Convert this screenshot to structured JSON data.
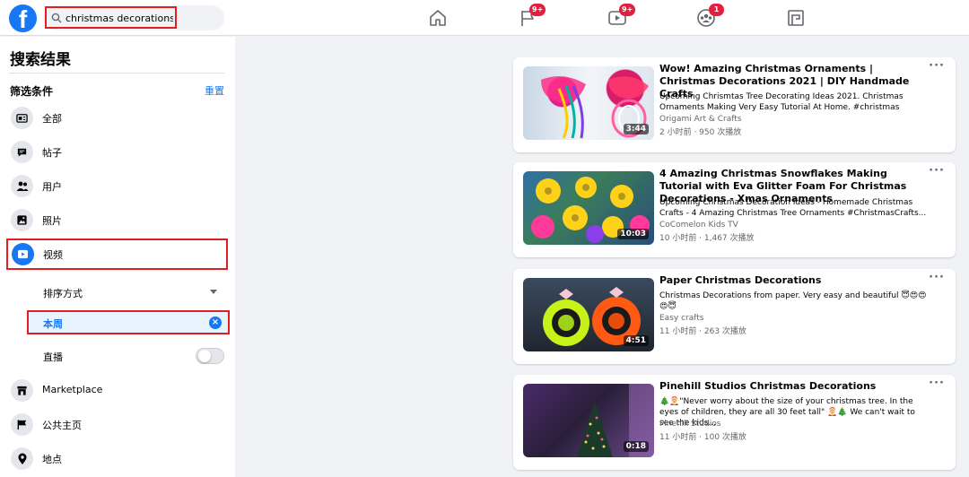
{
  "header": {
    "logo_letter": "f",
    "search": {
      "value": "christmas decorations",
      "placeholder": ""
    },
    "nav": [
      {
        "name": "home",
        "badge": ""
      },
      {
        "name": "pages",
        "badge": "9+"
      },
      {
        "name": "watch",
        "badge": "9+"
      },
      {
        "name": "groups",
        "badge": "1"
      },
      {
        "name": "gaming",
        "badge": ""
      }
    ]
  },
  "sidebar": {
    "title": "搜索结果",
    "filters_label": "筛选条件",
    "reset_label": "重置",
    "items": [
      {
        "label": "全部",
        "icon": "all-icon"
      },
      {
        "label": "帖子",
        "icon": "posts-icon"
      },
      {
        "label": "用户",
        "icon": "people-icon"
      },
      {
        "label": "照片",
        "icon": "photos-icon"
      },
      {
        "label": "视频",
        "icon": "video-icon",
        "active": true
      },
      {
        "label": "Marketplace",
        "icon": "marketplace-icon"
      },
      {
        "label": "公共主页",
        "icon": "flag-icon"
      },
      {
        "label": "地点",
        "icon": "location-icon"
      }
    ],
    "video_sub": {
      "sort_label": "排序方式",
      "this_week_label": "本周",
      "live_label": "直播",
      "live_on": false
    }
  },
  "results": [
    {
      "title": "Wow! Amazing Christmas Ornaments | Christmas Decorations 2021 | DIY Handmade Crafts",
      "description": "Upcoming Chrismtas Tree Decorating Ideas 2021. Christmas Ornaments Making Very Easy Tutorial At Home. #christmas",
      "source": "Origami Art & Crafts",
      "meta": "2 小时前 · 950 次播放",
      "duration": "3:44"
    },
    {
      "title": "4 Amazing Christmas Snowflakes Making Tutorial with Eva Glitter Foam For Christmas Decorations - Xmas Ornaments",
      "description": "Upcoming Christmas Decoration Ideas - Homemade Christmas Crafts - 4 Amazing Christmas Tree Ornaments #ChristmasCrafts...",
      "source": "CoComelon Kids TV",
      "meta": "10 小时前 · 1,467 次播放",
      "duration": "10:03"
    },
    {
      "title": "Paper Christmas Decorations",
      "description": "Christmas Decorations from paper. Very easy and beautiful 😇😍😍😍😇",
      "source": "Easy crafts",
      "meta": "11 小时前 · 263 次播放",
      "duration": "4:51"
    },
    {
      "title": "Pinehill Studios Christmas Decorations",
      "description": "🎄🤶\"Never worry about the size of your christmas tree. In the eyes of children, they are all 30 feet tall\" 🤶🎄 We can't wait to see the kids...",
      "source": "Pinehill Studios",
      "meta": "11 小时前 · 100 次播放",
      "duration": "0:18"
    }
  ],
  "colors": {
    "brand": "#1877f2",
    "highlight": "#e02020",
    "badge": "#e41e3f"
  }
}
